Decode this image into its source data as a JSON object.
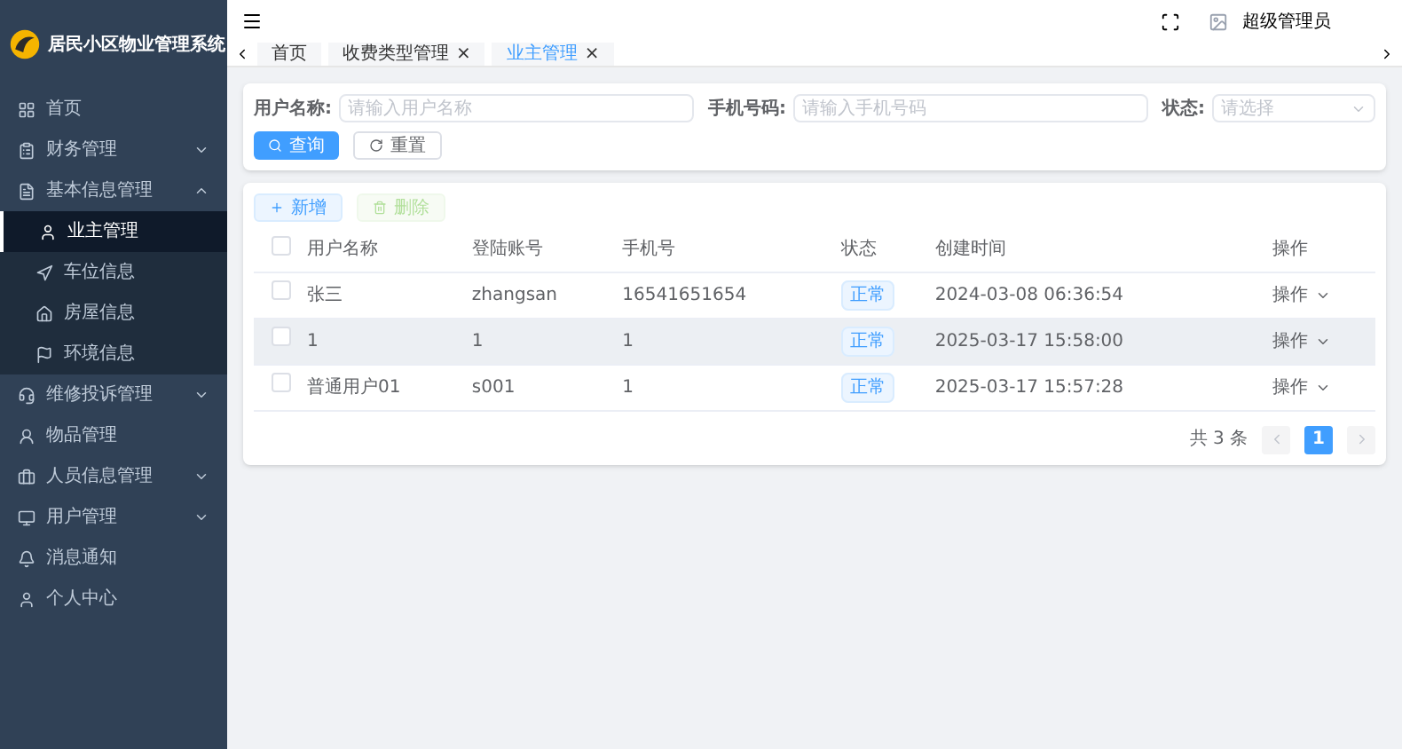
{
  "sidebar": {
    "title": "居民小区物业管理系统",
    "items": [
      {
        "label": "首页"
      },
      {
        "label": "财务管理",
        "expanded": false
      },
      {
        "label": "基本信息管理",
        "expanded": true,
        "children": [
          {
            "label": "业主管理",
            "selected": true
          },
          {
            "label": "车位信息",
            "selected": false
          },
          {
            "label": "房屋信息",
            "selected": false
          },
          {
            "label": "环境信息",
            "selected": false
          }
        ]
      },
      {
        "label": "维修投诉管理",
        "expanded": false
      },
      {
        "label": "物品管理"
      },
      {
        "label": "人员信息管理",
        "expanded": false
      },
      {
        "label": "用户管理",
        "expanded": false
      },
      {
        "label": "消息通知"
      },
      {
        "label": "个人中心"
      }
    ]
  },
  "header": {
    "user": "超级管理员"
  },
  "tabs": [
    {
      "label": "首页",
      "selected": false
    },
    {
      "label": "收费类型管理",
      "selected": false,
      "close": "×"
    },
    {
      "label": "业主管理",
      "selected": true,
      "close": "×"
    }
  ],
  "search": {
    "fields": [
      {
        "kind": "input",
        "label": "用户名称:",
        "placeholder": "请输入用户名称"
      },
      {
        "kind": "input",
        "label": "手机号码:",
        "placeholder": "请输入手机号码"
      },
      {
        "kind": "select",
        "label": "状态:",
        "placeholder": "请选择"
      }
    ],
    "buttons": [
      {
        "kind": "primary",
        "label": "查询"
      },
      {
        "kind": "reset",
        "label": "重置"
      }
    ]
  },
  "toolbar": [
    {
      "kind": "add",
      "label": "新增",
      "disabled": false
    },
    {
      "kind": "delete",
      "label": "删除",
      "disabled": true
    }
  ],
  "table": {
    "all_checked": false,
    "columns": [
      "用户名称",
      "登陆账号",
      "手机号",
      "状态",
      "创建时间",
      "操作"
    ],
    "rows": [
      {
        "checked": false,
        "highlighted": false,
        "cells": [
          "张三",
          "zhangsan",
          "16541651654",
          "正常",
          "2024-03-08 06:36:54",
          "操作"
        ]
      },
      {
        "checked": false,
        "highlighted": true,
        "cells": [
          "1",
          "1",
          "1",
          "正常",
          "2025-03-17 15:58:00",
          "操作"
        ]
      },
      {
        "checked": false,
        "highlighted": false,
        "cells": [
          "普通用户01",
          "s001",
          "1",
          "正常",
          "2025-03-17 15:57:28",
          "操作"
        ]
      }
    ]
  },
  "pagination": {
    "total": "共 3 条",
    "pages": [
      {
        "label": "1",
        "selected": true
      }
    ]
  }
}
